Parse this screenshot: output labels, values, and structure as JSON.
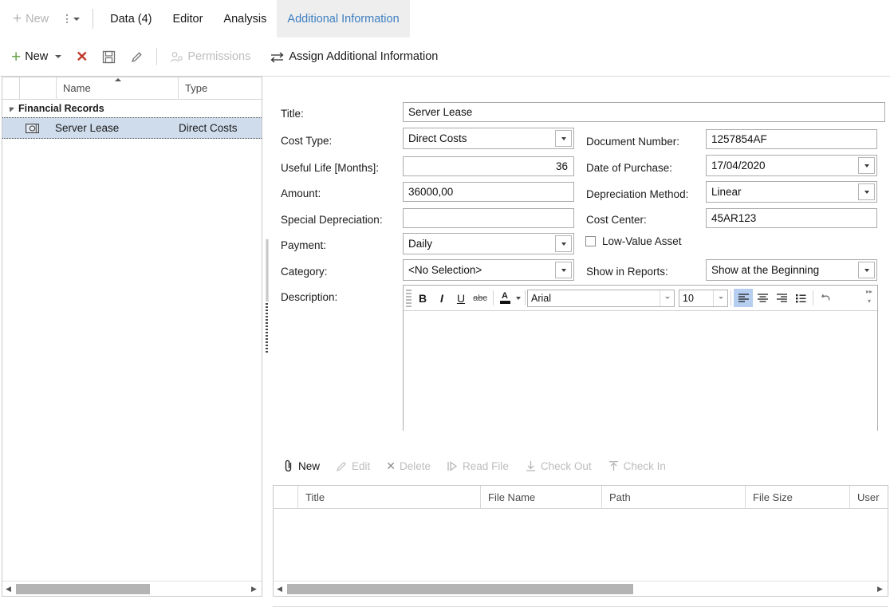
{
  "tabbar": {
    "new_label": "New",
    "tabs": [
      {
        "label": "Data (4)",
        "active": false
      },
      {
        "label": "Editor",
        "active": false
      },
      {
        "label": "Analysis",
        "active": false
      },
      {
        "label": "Additional Information",
        "active": true
      }
    ]
  },
  "toolbar": {
    "new_label": "New",
    "delete_label": "",
    "save_label": "",
    "edit_label": "",
    "permissions_label": "Permissions",
    "assign_label": "Assign Additional Information"
  },
  "tree": {
    "columns": [
      "",
      "",
      "Name",
      "Type"
    ],
    "sort_column": "Name",
    "sort_direction": "ascending",
    "group": {
      "label": "Financial Records",
      "expanded": true
    },
    "rows": [
      {
        "icon": "money-icon",
        "name": "Server Lease",
        "type": "Direct Costs",
        "selected": true
      }
    ]
  },
  "form": {
    "title": {
      "label": "Title:",
      "value": "Server Lease"
    },
    "cost_type": {
      "label": "Cost Type:",
      "value": "Direct Costs"
    },
    "useful_life": {
      "label": "Useful Life [Months]:",
      "value": "36"
    },
    "amount": {
      "label": "Amount:",
      "value": "36000,00"
    },
    "special_depreciation": {
      "label": "Special Depreciation:",
      "value": ""
    },
    "payment": {
      "label": "Payment:",
      "value": "Daily"
    },
    "category": {
      "label": "Category:",
      "value": "<No Selection>"
    },
    "description": {
      "label": "Description:",
      "value": ""
    },
    "document_number": {
      "label": "Document Number:",
      "value": "1257854AF"
    },
    "date_of_purchase": {
      "label": "Date of Purchase:",
      "value": "17/04/2020"
    },
    "depreciation_method": {
      "label": "Depreciation Method:",
      "value": "Linear"
    },
    "cost_center": {
      "label": "Cost Center:",
      "value": "45AR123"
    },
    "low_value_asset": {
      "label": "Low-Value Asset",
      "checked": false
    },
    "show_in_reports": {
      "label": "Show in Reports:",
      "value": "Show at the Beginning"
    }
  },
  "editor": {
    "bold": "B",
    "italic": "I",
    "underline": "U",
    "strikethrough": "abc",
    "font_color": "A",
    "font_family": "Arial",
    "font_size": "10",
    "align_left_selected": true,
    "highlight_color": "#b6cef0"
  },
  "attachments": {
    "actions": [
      {
        "label": "New",
        "enabled": true,
        "icon": "paperclip-icon"
      },
      {
        "label": "Edit",
        "enabled": false,
        "icon": "pencil-icon"
      },
      {
        "label": "Delete",
        "enabled": false,
        "icon": "x-icon"
      },
      {
        "label": "Read File",
        "enabled": false,
        "icon": "read-file-icon"
      },
      {
        "label": "Check Out",
        "enabled": false,
        "icon": "download-icon"
      },
      {
        "label": "Check In",
        "enabled": false,
        "icon": "upload-icon"
      }
    ],
    "columns": [
      "",
      "Title",
      "File Name",
      "Path",
      "File Size",
      "User"
    ],
    "rows": []
  }
}
